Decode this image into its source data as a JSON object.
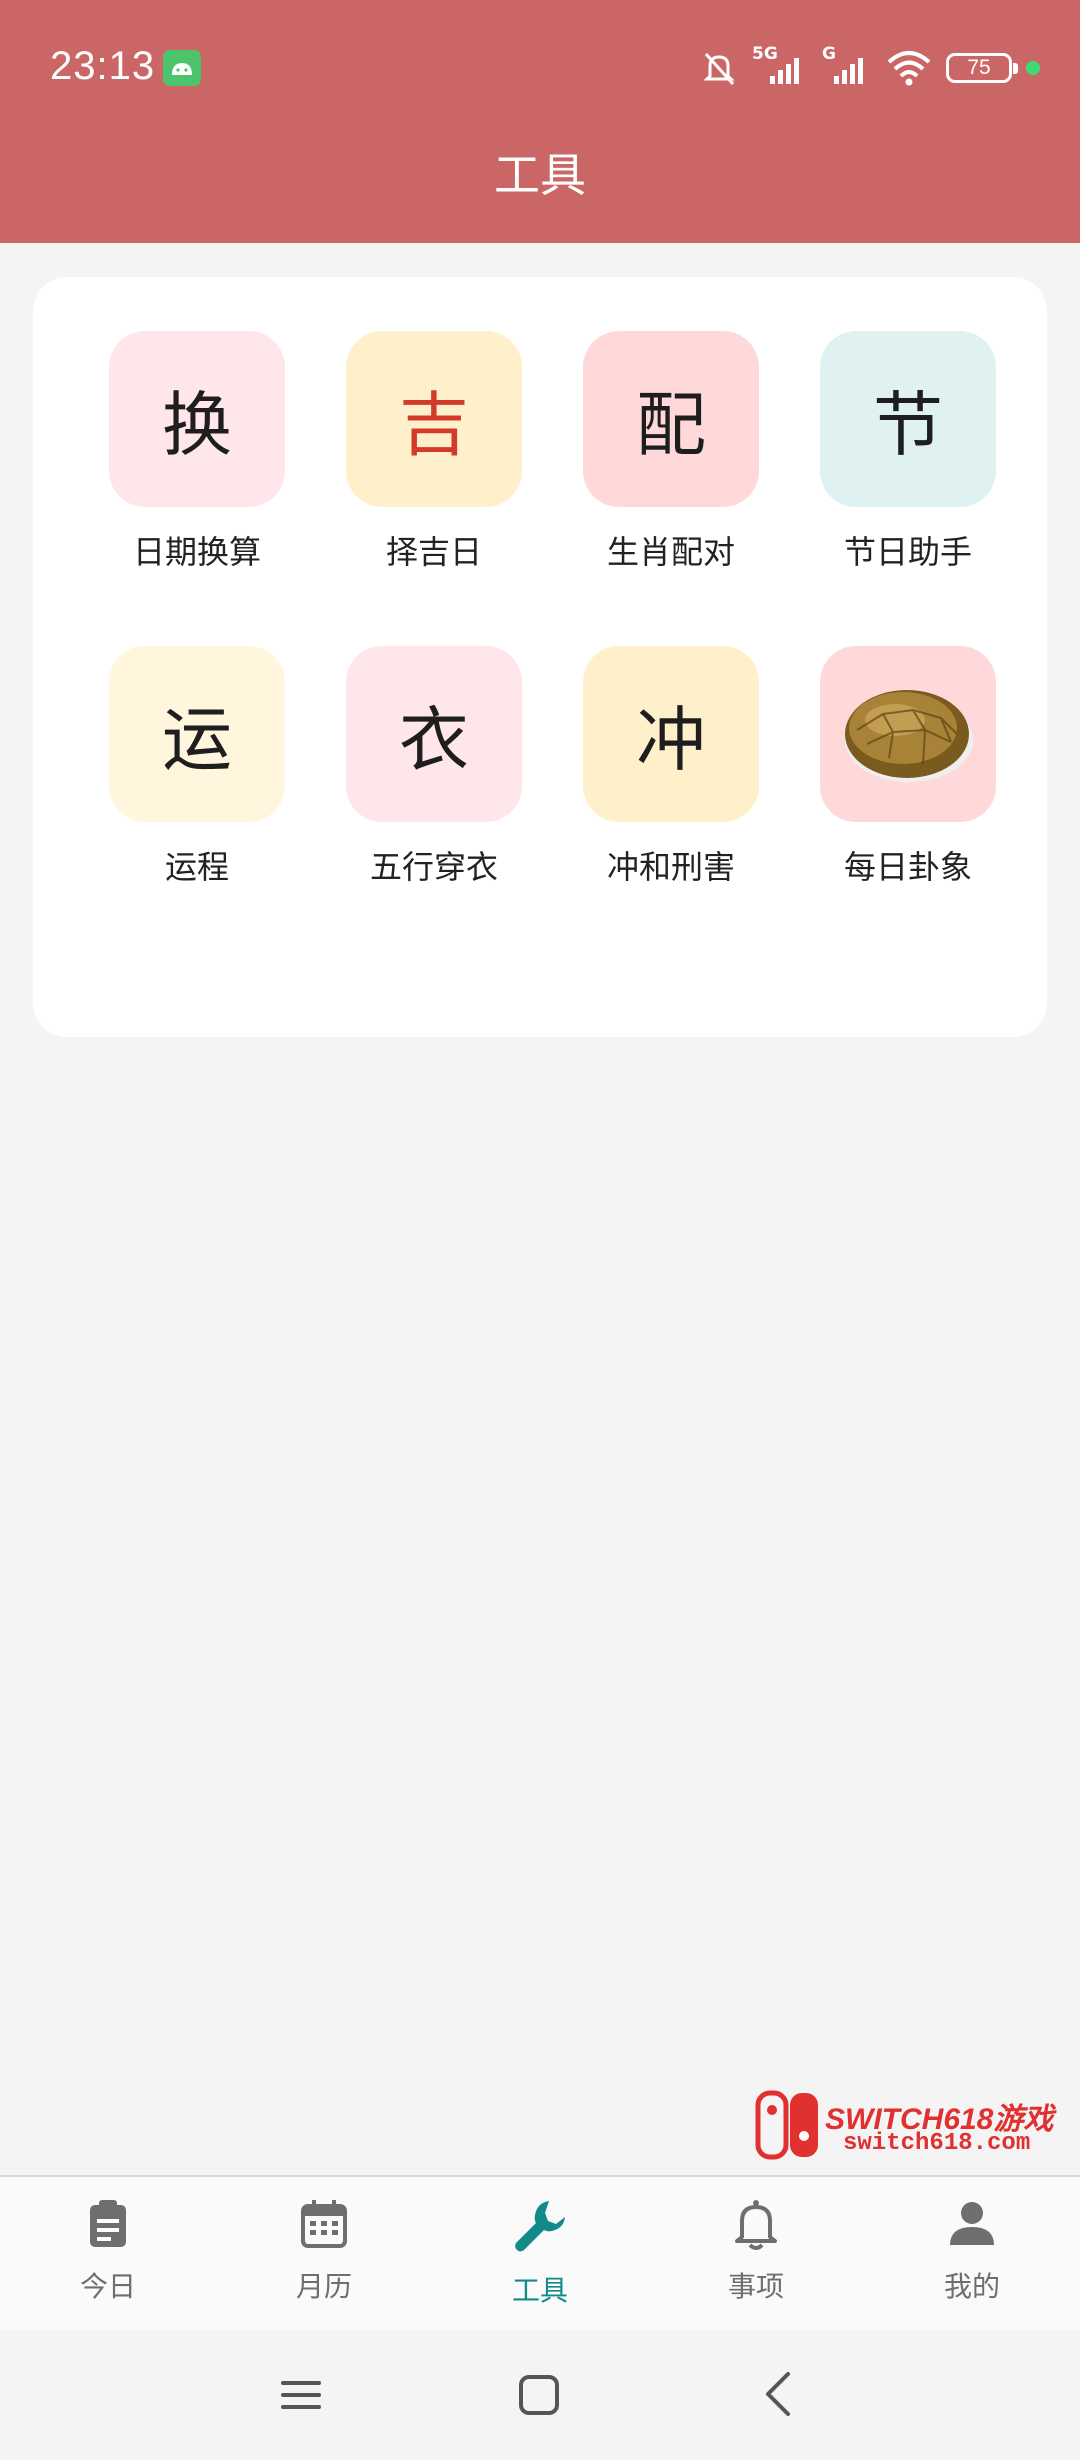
{
  "status": {
    "time": "23:13",
    "battery": "75",
    "net1": "5G",
    "net2": "G"
  },
  "header": {
    "title": "工具"
  },
  "tools": [
    {
      "glyph": "换",
      "label": "日期换算",
      "bg": "#ffe6ea",
      "color": "#1e1e1e"
    },
    {
      "glyph": "吉",
      "label": "择吉日",
      "bg": "#fff0cc",
      "color": "#d23a2a"
    },
    {
      "glyph": "配",
      "label": "生肖配对",
      "bg": "#ffd9d9",
      "color": "#1e1e1e"
    },
    {
      "glyph": "节",
      "label": "节日助手",
      "bg": "#dff1f0",
      "color": "#1e1e1e"
    },
    {
      "glyph": "运",
      "label": "运程",
      "bg": "#fff6dd",
      "color": "#1e1e1e"
    },
    {
      "glyph": "衣",
      "label": "五行穿衣",
      "bg": "#ffe6ea",
      "color": "#1e1e1e"
    },
    {
      "glyph": "冲",
      "label": "冲和刑害",
      "bg": "#fff0cc",
      "color": "#1e1e1e"
    },
    {
      "glyph": "",
      "label": "每日卦象",
      "bg": "#ffd9d9",
      "color": "#1e1e1e",
      "icon": "turtle-shell-icon"
    }
  ],
  "nav": [
    {
      "label": "今日",
      "icon": "clipboard-icon"
    },
    {
      "label": "月历",
      "icon": "calendar-icon"
    },
    {
      "label": "工具",
      "icon": "wrench-icon",
      "active": true
    },
    {
      "label": "事项",
      "icon": "bell-icon"
    },
    {
      "label": "我的",
      "icon": "person-icon"
    }
  ],
  "watermark": {
    "title": "SWITCH618游戏",
    "url": "switch618.com"
  },
  "colors": {
    "header": "#cb6666",
    "accent": "#138a8a",
    "nav_inactive": "#6e6e6e"
  }
}
